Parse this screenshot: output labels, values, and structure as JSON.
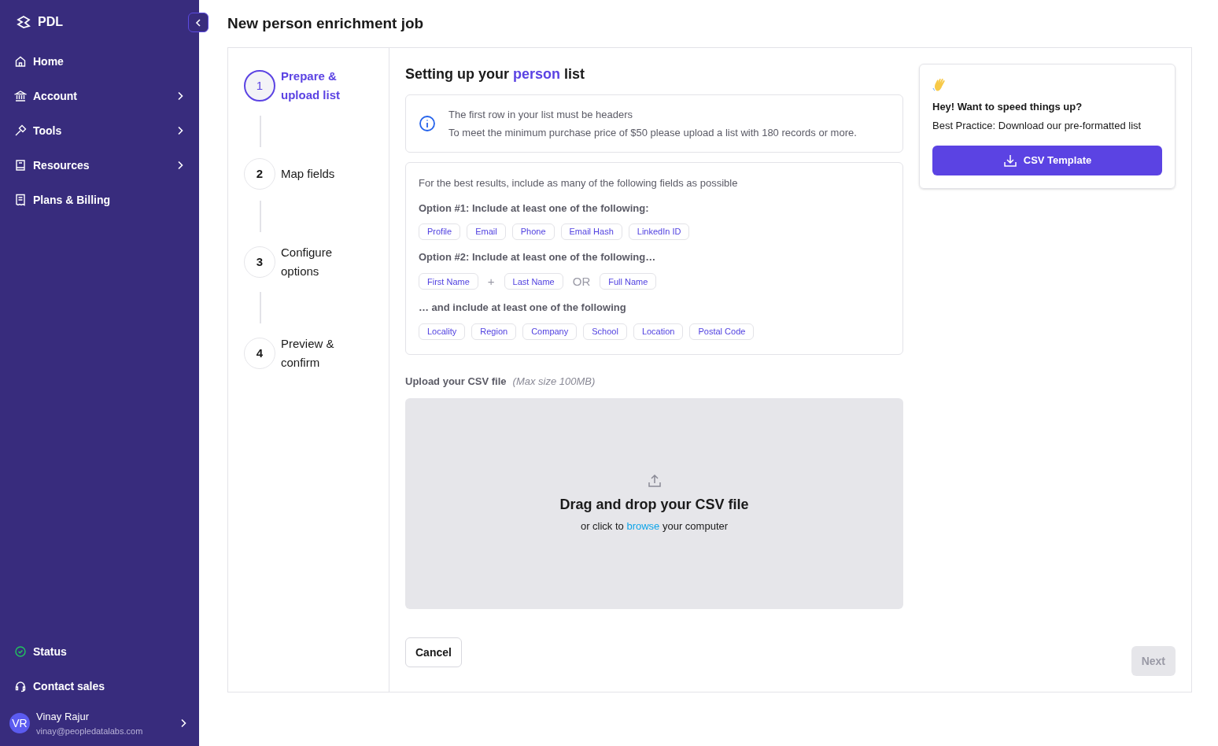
{
  "sidebar": {
    "logo": "PDL",
    "nav": [
      {
        "label": "Home",
        "has_submenu": false
      },
      {
        "label": "Account",
        "has_submenu": true
      },
      {
        "label": "Tools",
        "has_submenu": true
      },
      {
        "label": "Resources",
        "has_submenu": true
      },
      {
        "label": "Plans & Billing",
        "has_submenu": false
      }
    ],
    "bottom": [
      {
        "label": "Status"
      },
      {
        "label": "Contact sales"
      }
    ],
    "user": {
      "initials": "VR",
      "name": "Vinay Rajur",
      "email": "vinay@peopledatalabs.com"
    }
  },
  "title": "New person enrichment job",
  "steps": [
    {
      "number": "1",
      "label": "Prepare & upload list",
      "selected": true
    },
    {
      "number": "2",
      "label": "Map fields",
      "selected": false
    },
    {
      "number": "3",
      "label": "Configure options",
      "selected": false
    },
    {
      "number": "4",
      "label": "Preview & confirm",
      "selected": false
    }
  ],
  "heading": {
    "before": "Setting up your",
    "highlight": "person",
    "after": "list"
  },
  "notice": [
    "The first row in your list must be headers",
    "To meet the minimum purchase price of $50 please upload a list with 180 records or more."
  ],
  "fields": {
    "intro": "For the best results, include as many of the following fields as possible",
    "groups": [
      {
        "title": "Option #1: Include at least one of the following:",
        "items": [
          {
            "kind": "tag",
            "text": "Profile"
          },
          {
            "kind": "tag",
            "text": "Email"
          },
          {
            "kind": "tag",
            "text": "Phone"
          },
          {
            "kind": "tag",
            "text": "Email Hash"
          },
          {
            "kind": "tag",
            "text": "LinkedIn ID"
          }
        ]
      },
      {
        "title": "Option #2: Include at least one of the following…",
        "items": [
          {
            "kind": "tag",
            "text": "First Name"
          },
          {
            "kind": "operator",
            "text": "+"
          },
          {
            "kind": "tag",
            "text": "Last Name"
          },
          {
            "kind": "operator",
            "text": "OR"
          },
          {
            "kind": "tag",
            "text": "Full Name"
          }
        ]
      },
      {
        "title": "… and include at least one of the following",
        "items": [
          {
            "kind": "tag",
            "text": "Locality"
          },
          {
            "kind": "tag",
            "text": "Region"
          },
          {
            "kind": "tag",
            "text": "Company"
          },
          {
            "kind": "tag",
            "text": "School"
          },
          {
            "kind": "tag",
            "text": "Location"
          },
          {
            "kind": "tag",
            "text": "Postal Code"
          }
        ]
      }
    ]
  },
  "upload": {
    "label": "Upload your CSV file",
    "hint": "(Max size 100MB)",
    "title": "Drag and drop your CSV file",
    "before": "or click to",
    "link": "browse",
    "after": "your computer"
  },
  "promo": {
    "title": "Hey! Want to speed things up?",
    "text": "Best Practice: Download our pre-formatted list",
    "button": "CSV Template"
  },
  "cancel": {
    "label": "Cancel"
  },
  "next": {
    "label": "Next",
    "disabled": true
  }
}
